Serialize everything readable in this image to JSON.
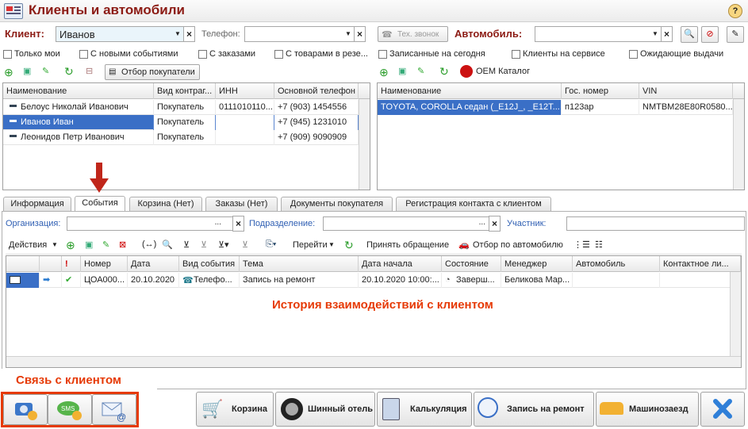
{
  "window": {
    "title": "Клиенты и автомобили",
    "help": "?"
  },
  "filters": {
    "client_label": "Клиент:",
    "client_value": "Иванов",
    "phone_label": "Телефон:",
    "phone_value": "",
    "tech_call": "Тех. звонок",
    "auto_label": "Автомобиль:",
    "auto_value": ""
  },
  "checkboxes_left": [
    "Только мои",
    "С новыми событиями",
    "С заказами",
    "С товарами в резе..."
  ],
  "checkboxes_right": [
    "Записанные на сегодня",
    "Клиенты на сервисе",
    "Ожидающие выдачи"
  ],
  "toolbar_left": {
    "buyers_filter": "Отбор покупатели"
  },
  "toolbar_right": {
    "oem": "OEM Каталог"
  },
  "clients_grid": {
    "columns": [
      "Наименование",
      "Вид контраг...",
      "ИНН",
      "Основной телефон"
    ],
    "rows": [
      [
        "Белоус Николай Иванович",
        "Покупатель",
        "0111010110...",
        "+7 (903) 1454556"
      ],
      [
        "Иванов Иван",
        "Покупатель",
        "",
        "+7 (945) 1231010"
      ],
      [
        "Леонидов Петр Иванович",
        "Покупатель",
        "",
        "+7 (909) 9090909"
      ]
    ]
  },
  "cars_grid": {
    "columns": [
      "Наименование",
      "Гос. номер",
      "VIN"
    ],
    "rows": [
      [
        "TOYOTA, COROLLA седан (_E12J_, _E12T...",
        "п123ар",
        "NMTBM28E80R0580..."
      ]
    ]
  },
  "tabs": [
    "Информация",
    "События",
    "Корзина (Нет)",
    "Заказы (Нет)",
    "Документы покупателя",
    "Регистрация контакта с клиентом"
  ],
  "event_filters": {
    "org": "Организация:",
    "dept": "Подразделение:",
    "participant": "Участник:"
  },
  "events_toolbar": {
    "actions": "Действия",
    "goto": "Перейти",
    "accept": "Принять обращение",
    "by_car": "Отбор по автомобилю"
  },
  "events_grid": {
    "columns": [
      "Номер",
      "Дата",
      "Вид события",
      "Тема",
      "Дата начала",
      "Состояние",
      "Менеджер",
      "Автомобиль",
      "Контактное ли..."
    ],
    "rows": [
      [
        "ЦОА000...",
        "20.10.2020",
        "Телефо...",
        "Запись на ремонт",
        "20.10.2020 10:00:...",
        "Заверш...",
        "Беликова Мар...",
        ""
      ]
    ]
  },
  "annotations": {
    "history": "История взаимодействий с клиентом",
    "contact": "Связь с клиентом"
  },
  "bottom_buttons": [
    "Корзина",
    "Шинный отель",
    "Калькуляция",
    "Запись на ремонт",
    "Машинозаезд"
  ],
  "colors": {
    "title": "#8c1b14",
    "accent": "#e63a06",
    "selection": "#3a6fc6"
  }
}
